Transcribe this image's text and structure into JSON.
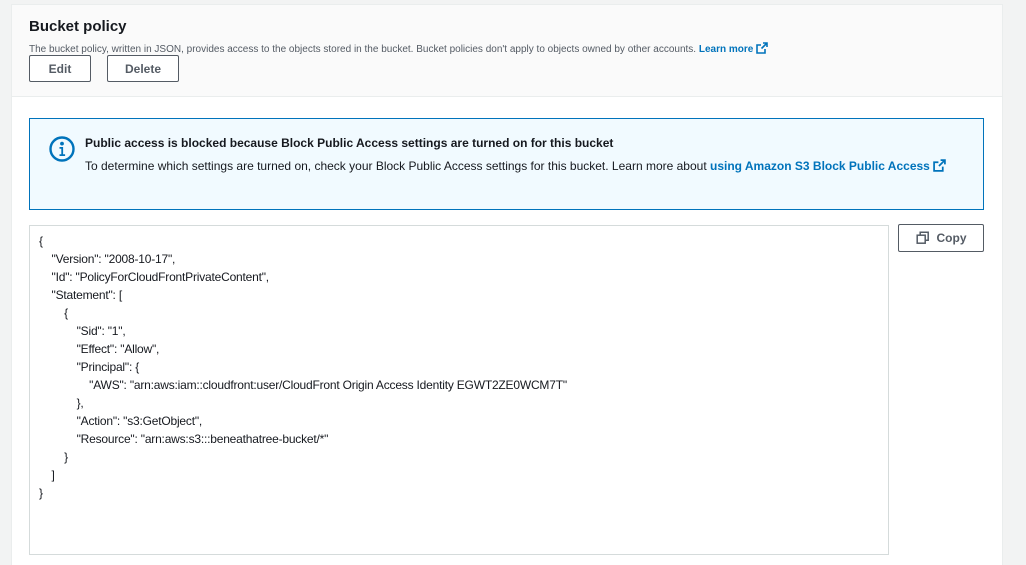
{
  "section": {
    "title": "Bucket policy",
    "description": "The bucket policy, written in JSON, provides access to the objects stored in the bucket. Bucket policies don't apply to objects owned by other accounts.",
    "learn_more": "Learn more",
    "edit_label": "Edit",
    "delete_label": "Delete"
  },
  "alert": {
    "title": "Public access is blocked because Block Public Access settings are turned on for this bucket",
    "body": "To determine which settings are turned on, check your Block Public Access settings for this bucket. Learn more about",
    "link": "using Amazon S3 Block Public Access",
    "icon": "info-icon"
  },
  "policy": {
    "text": "{\n    \"Version\": \"2008-10-17\",\n    \"Id\": \"PolicyForCloudFrontPrivateContent\",\n    \"Statement\": [\n        {\n            \"Sid\": \"1\",\n            \"Effect\": \"Allow\",\n            \"Principal\": {\n                \"AWS\": \"arn:aws:iam::cloudfront:user/CloudFront Origin Access Identity EGWT2ZE0WCM7T\"\n            },\n            \"Action\": \"s3:GetObject\",\n            \"Resource\": \"arn:aws:s3:::beneathatree-bucket/*\"\n        }\n    ]\n}",
    "copy_label": "Copy"
  },
  "colors": {
    "link": "#0073bb",
    "alert_bg": "#f1faff",
    "alert_border": "#0073bb"
  }
}
